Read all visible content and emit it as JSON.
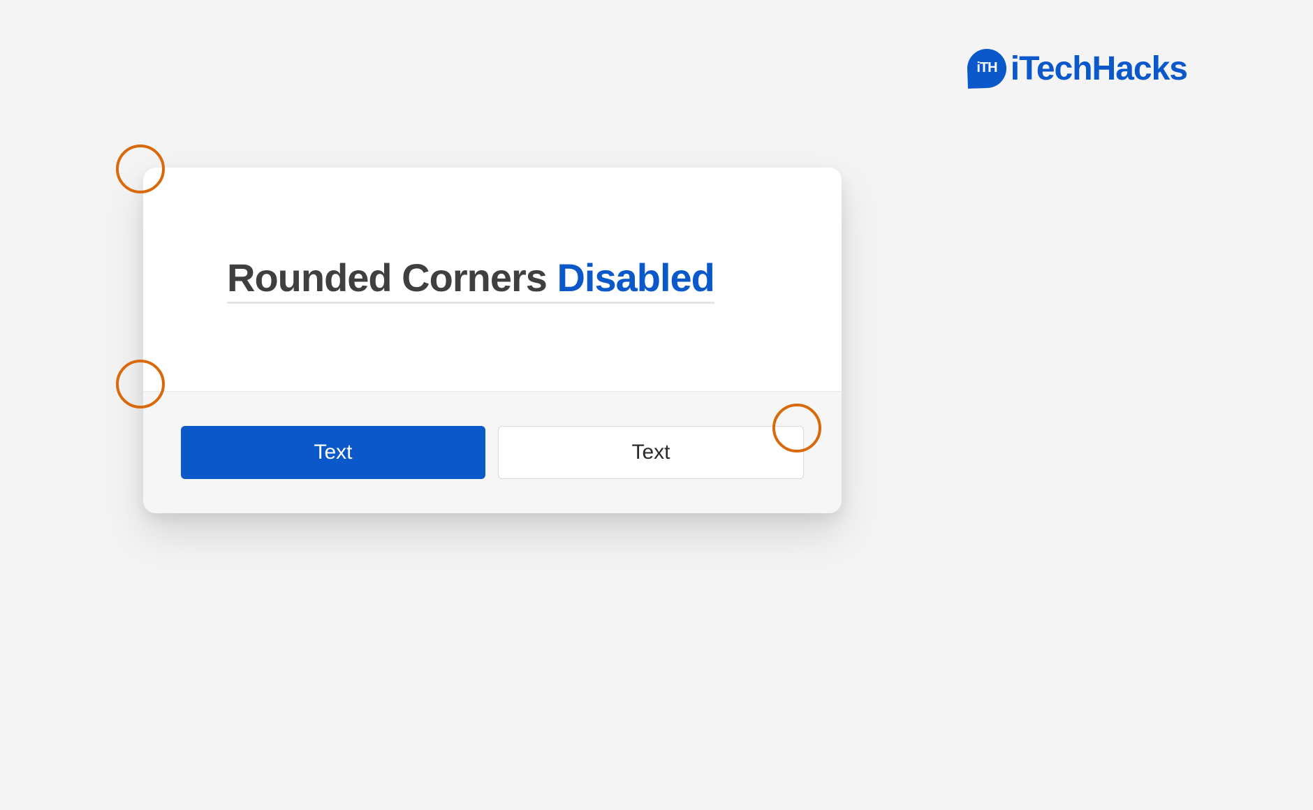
{
  "brand": {
    "name": "iTechHacks",
    "badge_text": "iTH"
  },
  "dialog": {
    "heading_main": "Rounded Corners ",
    "heading_accent": "Disabled",
    "buttons": {
      "primary_label": "Text",
      "secondary_label": "Text"
    }
  },
  "colors": {
    "brand_blue": "#0a58c9",
    "annotation_orange": "#d9690b",
    "heading_dark": "#3f3f3f"
  }
}
